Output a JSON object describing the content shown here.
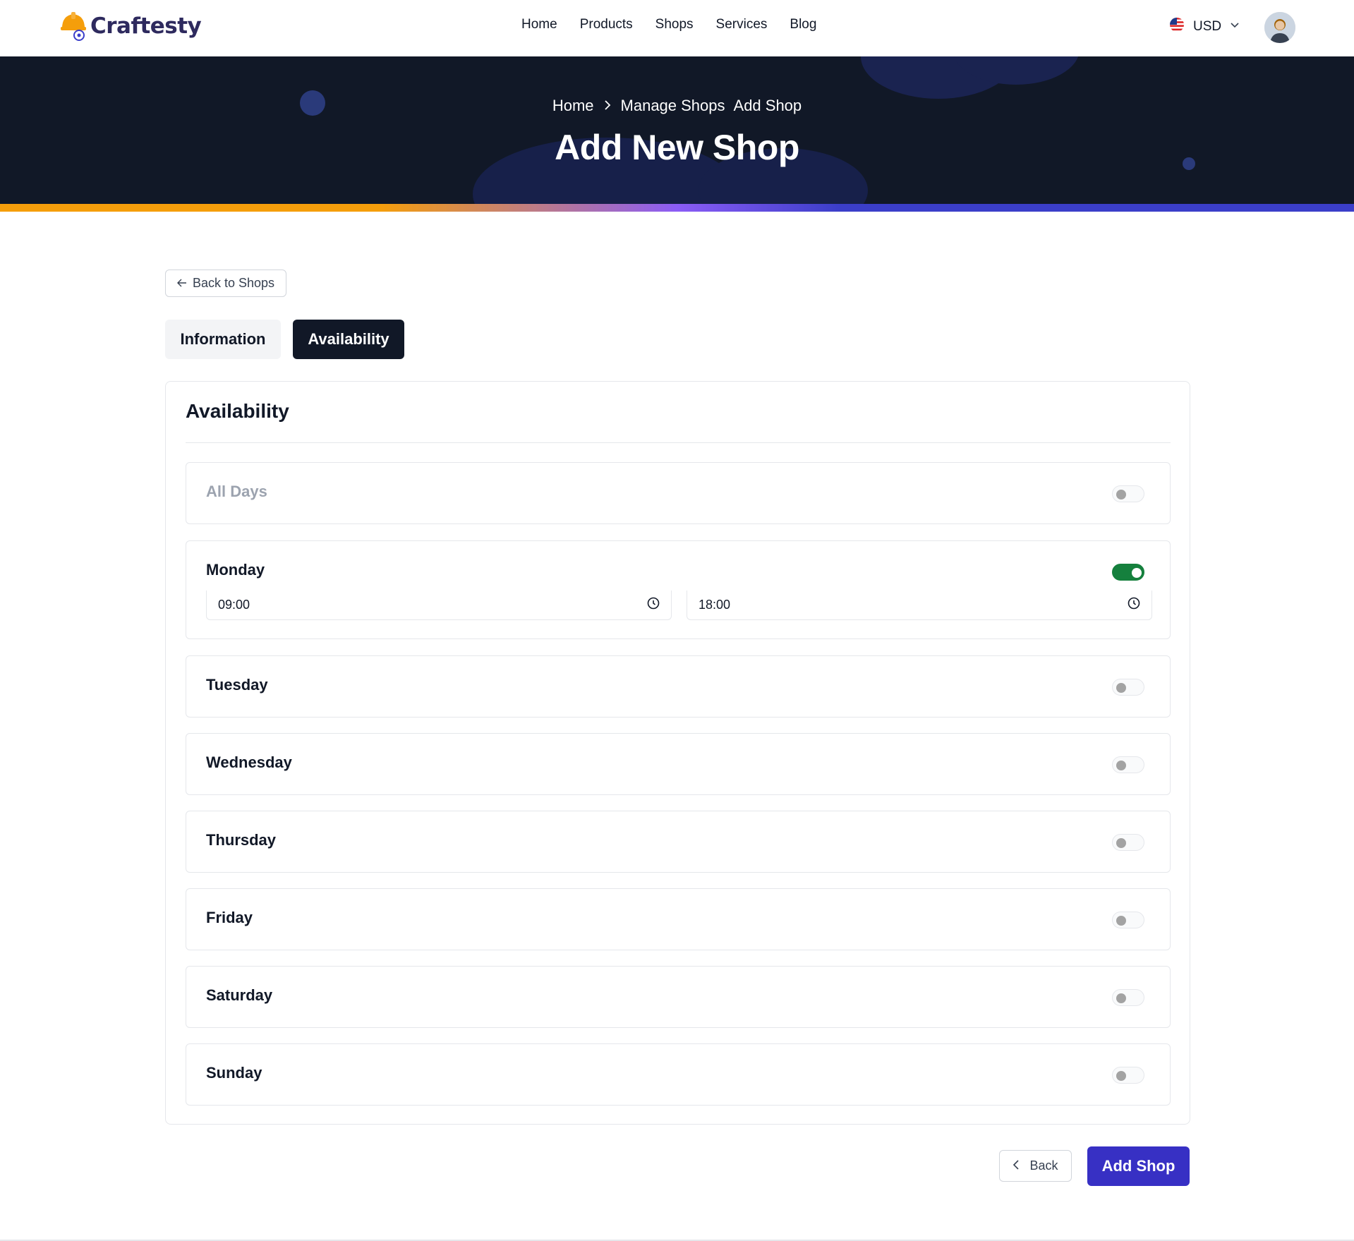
{
  "brand": {
    "name": "Craftesty",
    "accent": "#3730c4",
    "orange": "#f59e0b"
  },
  "nav": {
    "items": [
      {
        "label": "Home"
      },
      {
        "label": "Products"
      },
      {
        "label": "Shops"
      },
      {
        "label": "Services"
      },
      {
        "label": "Blog"
      }
    ]
  },
  "currency": {
    "label": "USD",
    "flag_icon": "us-flag-icon"
  },
  "hero": {
    "breadcrumb": [
      "Home",
      "Manage Shops",
      "Add Shop"
    ],
    "title": "Add New Shop"
  },
  "back_to_shops": "Back to Shops",
  "tabs": [
    {
      "label": "Information",
      "active": false
    },
    {
      "label": "Availability",
      "active": true
    }
  ],
  "availability": {
    "title": "Availability",
    "all_days": {
      "label": "All Days",
      "enabled": false
    },
    "days": [
      {
        "label": "Monday",
        "enabled": true,
        "start": "09:00",
        "end": "18:00"
      },
      {
        "label": "Tuesday",
        "enabled": false
      },
      {
        "label": "Wednesday",
        "enabled": false
      },
      {
        "label": "Thursday",
        "enabled": false
      },
      {
        "label": "Friday",
        "enabled": false
      },
      {
        "label": "Saturday",
        "enabled": false
      },
      {
        "label": "Sunday",
        "enabled": false
      }
    ]
  },
  "actions": {
    "back": "Back",
    "submit": "Add Shop"
  }
}
